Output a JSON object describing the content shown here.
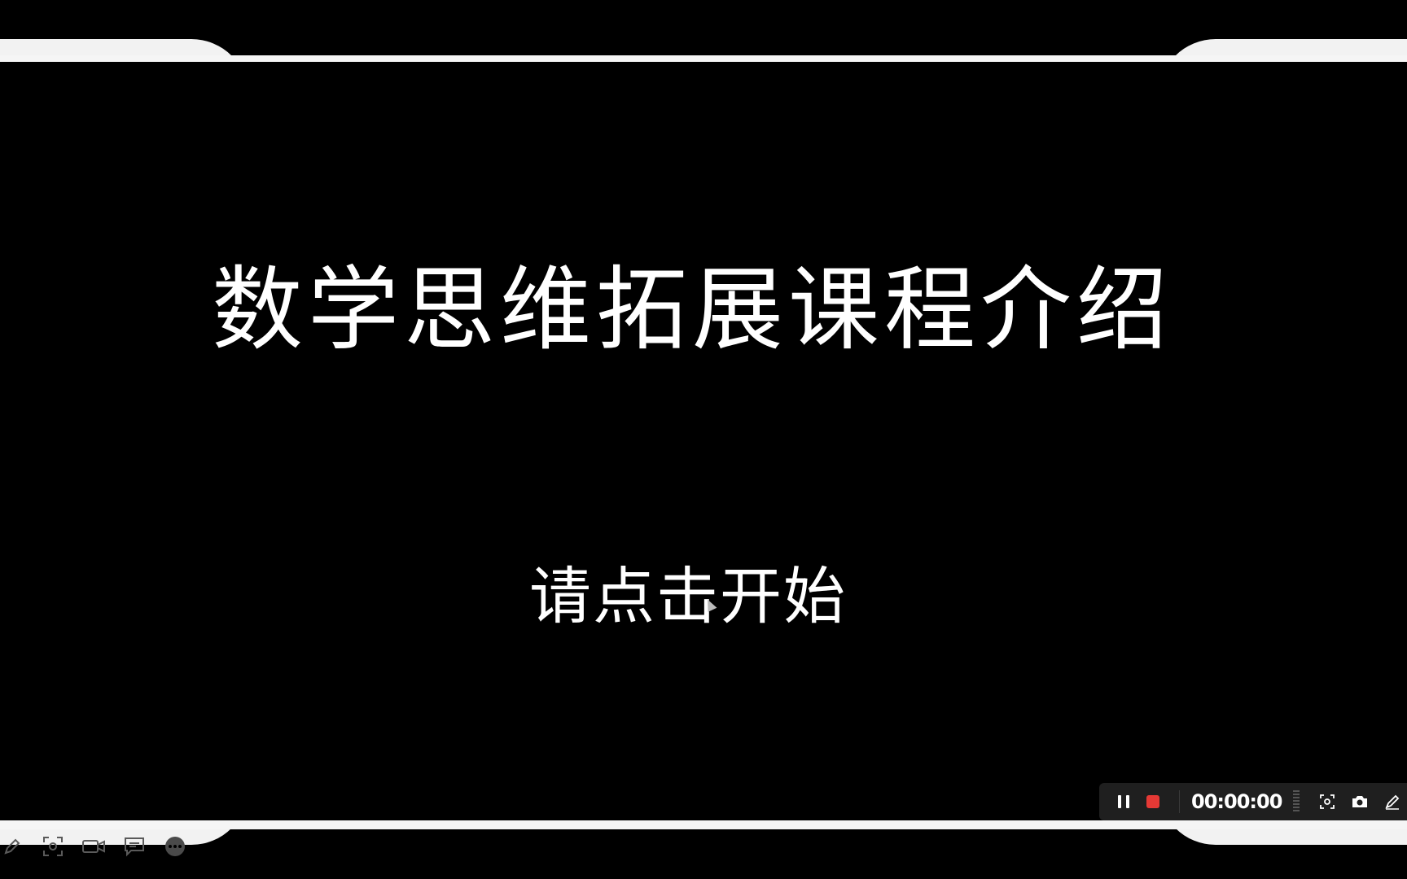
{
  "slide": {
    "title": "数学思维拓展课程介绍",
    "subtitle": "请点击开始"
  },
  "recorder": {
    "timer": "00:00:00",
    "stop_color": "#e53935"
  },
  "bottom_tools": [
    "pen-icon",
    "screenshot-icon",
    "camera-icon",
    "comment-icon",
    "more-icon"
  ]
}
